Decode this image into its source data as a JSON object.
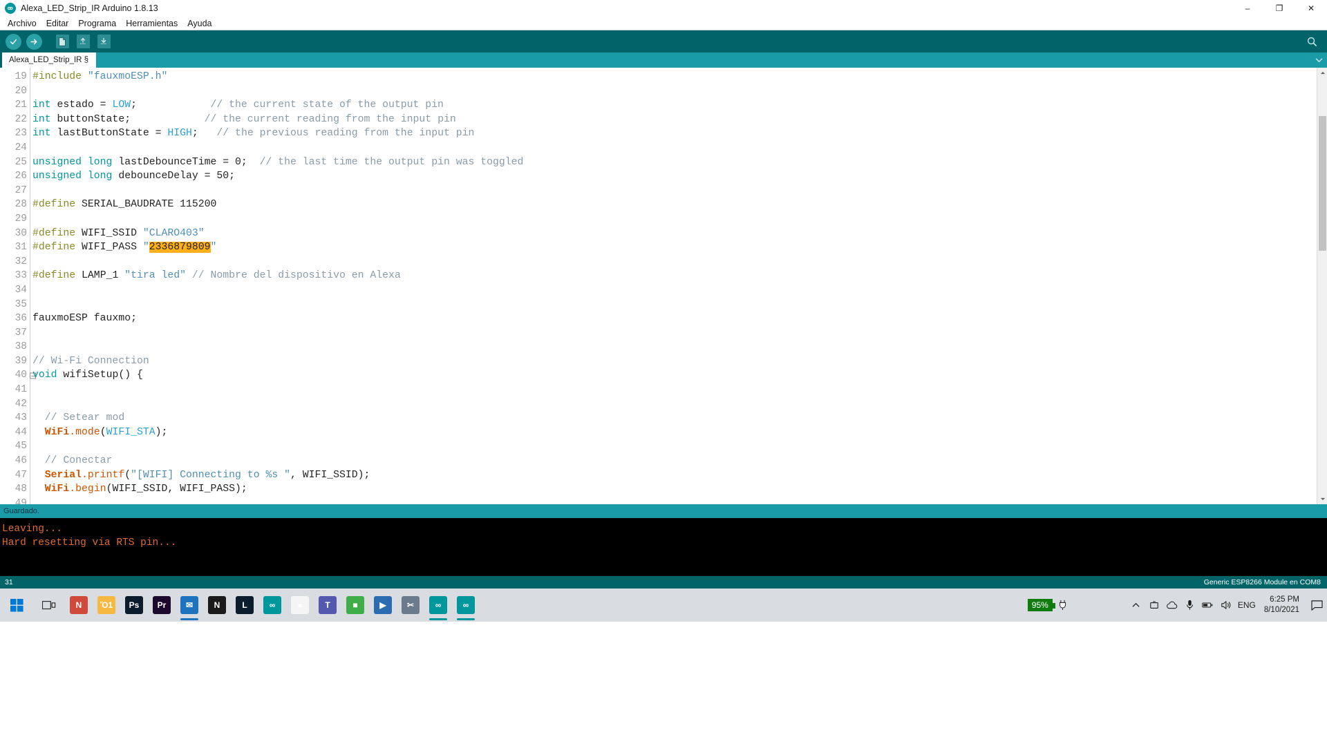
{
  "window": {
    "title": "Alexa_LED_Strip_IR Arduino 1.8.13",
    "app_icon": "arduino-infinity-icon",
    "minimize": "–",
    "maximize": "❐",
    "close": "✕"
  },
  "menubar": {
    "items": [
      {
        "label": "Archivo"
      },
      {
        "label": "Editar"
      },
      {
        "label": "Programa"
      },
      {
        "label": "Herramientas"
      },
      {
        "label": "Ayuda"
      }
    ]
  },
  "toolbar": {
    "verify": "verify-check-icon",
    "upload": "upload-arrow-icon",
    "new": "new-file-icon",
    "open": "open-folder-icon",
    "save": "save-icon",
    "serial_monitor": "serial-monitor-icon"
  },
  "tabs": {
    "items": [
      {
        "label": "Alexa_LED_Strip_IR §"
      }
    ],
    "overflow_icon": "chevron-down-icon"
  },
  "editor": {
    "first_line": 19,
    "lines": [
      {
        "n": 19,
        "tokens": [
          {
            "t": "#include ",
            "c": "pre"
          },
          {
            "t": "\"fauxmoESP.h\"",
            "c": "str"
          }
        ]
      },
      {
        "n": 20,
        "tokens": []
      },
      {
        "n": 21,
        "tokens": [
          {
            "t": "int",
            "c": "kw"
          },
          {
            "t": " estado = ",
            "c": ""
          },
          {
            "t": "LOW",
            "c": "lit"
          },
          {
            "t": ";            ",
            "c": ""
          },
          {
            "t": "// the current state of the output pin",
            "c": "cmt"
          }
        ]
      },
      {
        "n": 22,
        "tokens": [
          {
            "t": "int",
            "c": "kw"
          },
          {
            "t": " buttonState;            ",
            "c": ""
          },
          {
            "t": "// the current reading from the input pin",
            "c": "cmt"
          }
        ]
      },
      {
        "n": 23,
        "tokens": [
          {
            "t": "int",
            "c": "kw"
          },
          {
            "t": " lastButtonState = ",
            "c": ""
          },
          {
            "t": "HIGH",
            "c": "lit"
          },
          {
            "t": ";   ",
            "c": ""
          },
          {
            "t": "// the previous reading from the input pin",
            "c": "cmt"
          }
        ]
      },
      {
        "n": 24,
        "tokens": []
      },
      {
        "n": 25,
        "tokens": [
          {
            "t": "unsigned long",
            "c": "kw"
          },
          {
            "t": " lastDebounceTime = 0;  ",
            "c": ""
          },
          {
            "t": "// the last time the output pin was toggled",
            "c": "cmt"
          }
        ]
      },
      {
        "n": 26,
        "tokens": [
          {
            "t": "unsigned long",
            "c": "kw"
          },
          {
            "t": " debounceDelay = 50;",
            "c": ""
          }
        ]
      },
      {
        "n": 27,
        "tokens": []
      },
      {
        "n": 28,
        "tokens": [
          {
            "t": "#define",
            "c": "pre"
          },
          {
            "t": " SERIAL_BAUDRATE 115200",
            "c": ""
          }
        ]
      },
      {
        "n": 29,
        "tokens": []
      },
      {
        "n": 30,
        "tokens": [
          {
            "t": "#define",
            "c": "pre"
          },
          {
            "t": " WIFI_SSID ",
            "c": ""
          },
          {
            "t": "\"CLARO403\"",
            "c": "str"
          }
        ]
      },
      {
        "n": 31,
        "tokens": [
          {
            "t": "#define",
            "c": "pre"
          },
          {
            "t": " WIFI_PASS ",
            "c": ""
          },
          {
            "t": "\"",
            "c": "str"
          },
          {
            "t": "2336879809",
            "c": "sel"
          },
          {
            "t": "\"",
            "c": "str"
          }
        ]
      },
      {
        "n": 32,
        "tokens": []
      },
      {
        "n": 33,
        "tokens": [
          {
            "t": "#define",
            "c": "pre"
          },
          {
            "t": " LAMP_1 ",
            "c": ""
          },
          {
            "t": "\"tira led\"",
            "c": "str"
          },
          {
            "t": " ",
            "c": ""
          },
          {
            "t": "// Nombre del dispositivo en Alexa",
            "c": "cmt"
          }
        ]
      },
      {
        "n": 34,
        "tokens": []
      },
      {
        "n": 35,
        "tokens": []
      },
      {
        "n": 36,
        "tokens": [
          {
            "t": "fauxmoESP fauxmo;",
            "c": ""
          }
        ]
      },
      {
        "n": 37,
        "tokens": []
      },
      {
        "n": 38,
        "tokens": []
      },
      {
        "n": 39,
        "tokens": [
          {
            "t": "// Wi-Fi Connection",
            "c": "cmt"
          }
        ]
      },
      {
        "n": 40,
        "fold": true,
        "tokens": [
          {
            "t": "void",
            "c": "kw"
          },
          {
            "t": " wifiSetup() {",
            "c": ""
          }
        ]
      },
      {
        "n": 41,
        "tokens": []
      },
      {
        "n": 42,
        "tokens": []
      },
      {
        "n": 43,
        "tokens": [
          {
            "t": "  ",
            "c": ""
          },
          {
            "t": "// Setear mod",
            "c": "cmt"
          }
        ]
      },
      {
        "n": 44,
        "tokens": [
          {
            "t": "  ",
            "c": ""
          },
          {
            "t": "WiFi",
            "c": "obj"
          },
          {
            "t": ".mode",
            "c": "fn"
          },
          {
            "t": "(",
            "c": ""
          },
          {
            "t": "WIFI_STA",
            "c": "lit"
          },
          {
            "t": ");",
            "c": ""
          }
        ]
      },
      {
        "n": 45,
        "tokens": []
      },
      {
        "n": 46,
        "tokens": [
          {
            "t": "  ",
            "c": ""
          },
          {
            "t": "// Conectar",
            "c": "cmt"
          }
        ]
      },
      {
        "n": 47,
        "tokens": [
          {
            "t": "  ",
            "c": ""
          },
          {
            "t": "Serial",
            "c": "obj"
          },
          {
            "t": ".printf",
            "c": "fn"
          },
          {
            "t": "(",
            "c": ""
          },
          {
            "t": "\"[WIFI] Connecting to %s \"",
            "c": "str"
          },
          {
            "t": ", WIFI_SSID);",
            "c": ""
          }
        ]
      },
      {
        "n": 48,
        "tokens": [
          {
            "t": "  ",
            "c": ""
          },
          {
            "t": "WiFi",
            "c": "obj"
          },
          {
            "t": ".begin",
            "c": "fn"
          },
          {
            "t": "(WIFI_SSID, WIFI_PASS);",
            "c": ""
          }
        ]
      },
      {
        "n": 49,
        "tokens": []
      }
    ]
  },
  "status": {
    "saved_message": "Guardado."
  },
  "console": {
    "lines": [
      "Leaving...",
      "Hard resetting via RTS pin..."
    ]
  },
  "bottombar": {
    "cursor_line": "31",
    "board_info": "Generic ESP8266 Module en COM8"
  },
  "taskbar": {
    "start_icon": "windows-start-icon",
    "search_icon": "task-view-icon",
    "apps": [
      {
        "name": "app-notes",
        "label": "N",
        "color": "#d04a3b",
        "accent": "#d04a3b",
        "active": false
      },
      {
        "name": "app-explorer",
        "label": "Ὄ1",
        "color": "#f5b942",
        "accent": "#f5b942",
        "active": false
      },
      {
        "name": "app-photoshop",
        "label": "Ps",
        "color": "#0b1c2c",
        "accent": "#31a8ff",
        "active": false
      },
      {
        "name": "app-premiere",
        "label": "Pr",
        "color": "#1b0a2e",
        "accent": "#9999ff",
        "active": false
      },
      {
        "name": "app-mail",
        "label": "✉",
        "color": "#1e73be",
        "accent": "#1e73be",
        "active": true
      },
      {
        "name": "app-netflix",
        "label": "N",
        "color": "#1a1a1a",
        "accent": "#e50914",
        "active": false
      },
      {
        "name": "app-lightroom",
        "label": "L",
        "color": "#0b1c2c",
        "accent": "#31a8ff",
        "active": false
      },
      {
        "name": "app-arduino-1",
        "label": "∞",
        "color": "#00979c",
        "accent": "#00979c",
        "active": false
      },
      {
        "name": "app-chrome",
        "label": "●",
        "color": "#f5f5f5",
        "accent": "#4285f4",
        "active": false
      },
      {
        "name": "app-teams",
        "label": "T",
        "color": "#5558af",
        "accent": "#5558af",
        "active": false
      },
      {
        "name": "app-store",
        "label": "■",
        "color": "#3fae49",
        "accent": "#3fae49",
        "active": false
      },
      {
        "name": "app-media",
        "label": "▶",
        "color": "#2b6cb0",
        "accent": "#2b6cb0",
        "active": false
      },
      {
        "name": "app-snip",
        "label": "✂",
        "color": "#6b7b8c",
        "accent": "#6b7b8c",
        "active": false
      },
      {
        "name": "app-arduino-2",
        "label": "∞",
        "color": "#00979c",
        "accent": "#00979c",
        "active": true
      },
      {
        "name": "app-arduino-3",
        "label": "∞",
        "color": "#00979c",
        "accent": "#00979c",
        "active": true
      }
    ],
    "tray": {
      "battery_percent": "95%",
      "chevron": "show-hidden-icons",
      "language": "ENG",
      "time": "6:25 PM",
      "date": "8/10/2021",
      "action_center": "notifications-icon"
    }
  }
}
